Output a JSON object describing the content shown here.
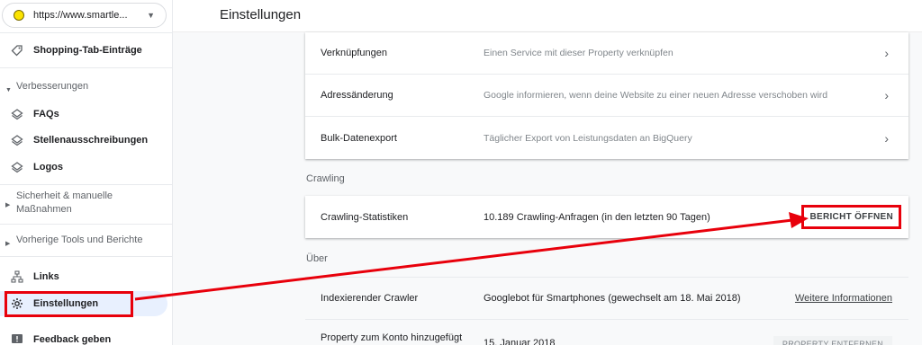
{
  "property": {
    "url": "https://www.smartle...",
    "chevron_icon": "chevron-down-icon"
  },
  "header": {
    "title": "Einstellungen"
  },
  "sidebar": {
    "shopping": "Shopping-Tab-Einträge",
    "verbesserungen": "Verbesserungen",
    "faqs": "FAQs",
    "stellen": "Stellenausschreibungen",
    "logos": "Logos",
    "sicherheit_1": "Sicherheit & manuelle",
    "sicherheit_2": "Maßnahmen",
    "vorherige": "Vorherige Tools und Berichte",
    "links": "Links",
    "einstellungen": "Einstellungen",
    "feedback": "Feedback geben"
  },
  "main": {
    "general_rows": [
      {
        "label": "Verknüpfungen",
        "desc": "Einen Service mit dieser Property verknüpfen"
      },
      {
        "label": "Adressänderung",
        "desc": "Google informieren, wenn deine Website zu einer neuen Adresse verschoben wird"
      },
      {
        "label": "Bulk-Datenexport",
        "desc": "Täglicher Export von Leistungsdaten an BigQuery"
      }
    ],
    "crawling_section": "Crawling",
    "crawling_row": {
      "label": "Crawling-Statistiken",
      "value": "10.189 Crawling-Anfragen (in den letzten 90 Tagen)",
      "button": "BERICHT ÖFFNEN"
    },
    "about_section": "Über",
    "about_rows": [
      {
        "label": "Indexierender Crawler",
        "value": "Googlebot für Smartphones (gewechselt am 18. Mai 2018)",
        "link": "Weitere Informationen"
      },
      {
        "label": "Property zum Konto hinzugefügt",
        "value": "15. Januar 2018",
        "button": "PROPERTY ENTFERNEN"
      }
    ]
  },
  "colors": {
    "highlight": "#e8000b",
    "active_nav_bg": "#e8f0fe"
  }
}
